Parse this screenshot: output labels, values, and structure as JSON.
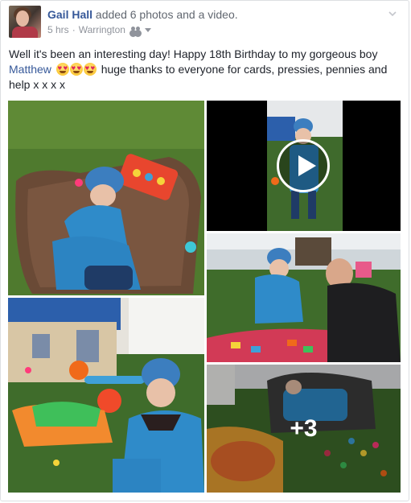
{
  "post": {
    "author": "Gail Hall",
    "action": "added 6 photos and a video.",
    "time": "5 hrs",
    "location": "Warrington",
    "audience_icon": "friends-icon",
    "text_before_mention": "Well it's been an interesting day! Happy 18th Birthday to my gorgeous boy ",
    "mention": "Matthew",
    "emoji_icon": "heart-eyes-emoji",
    "text_after_emojis": " huge thanks to everyone for cards, pressies, pennies and help x x x x",
    "more_photos_label": "+3"
  },
  "colors": {
    "link": "#365899",
    "meta": "#90949c",
    "text": "#1d2129",
    "border": "#dddfe2"
  }
}
